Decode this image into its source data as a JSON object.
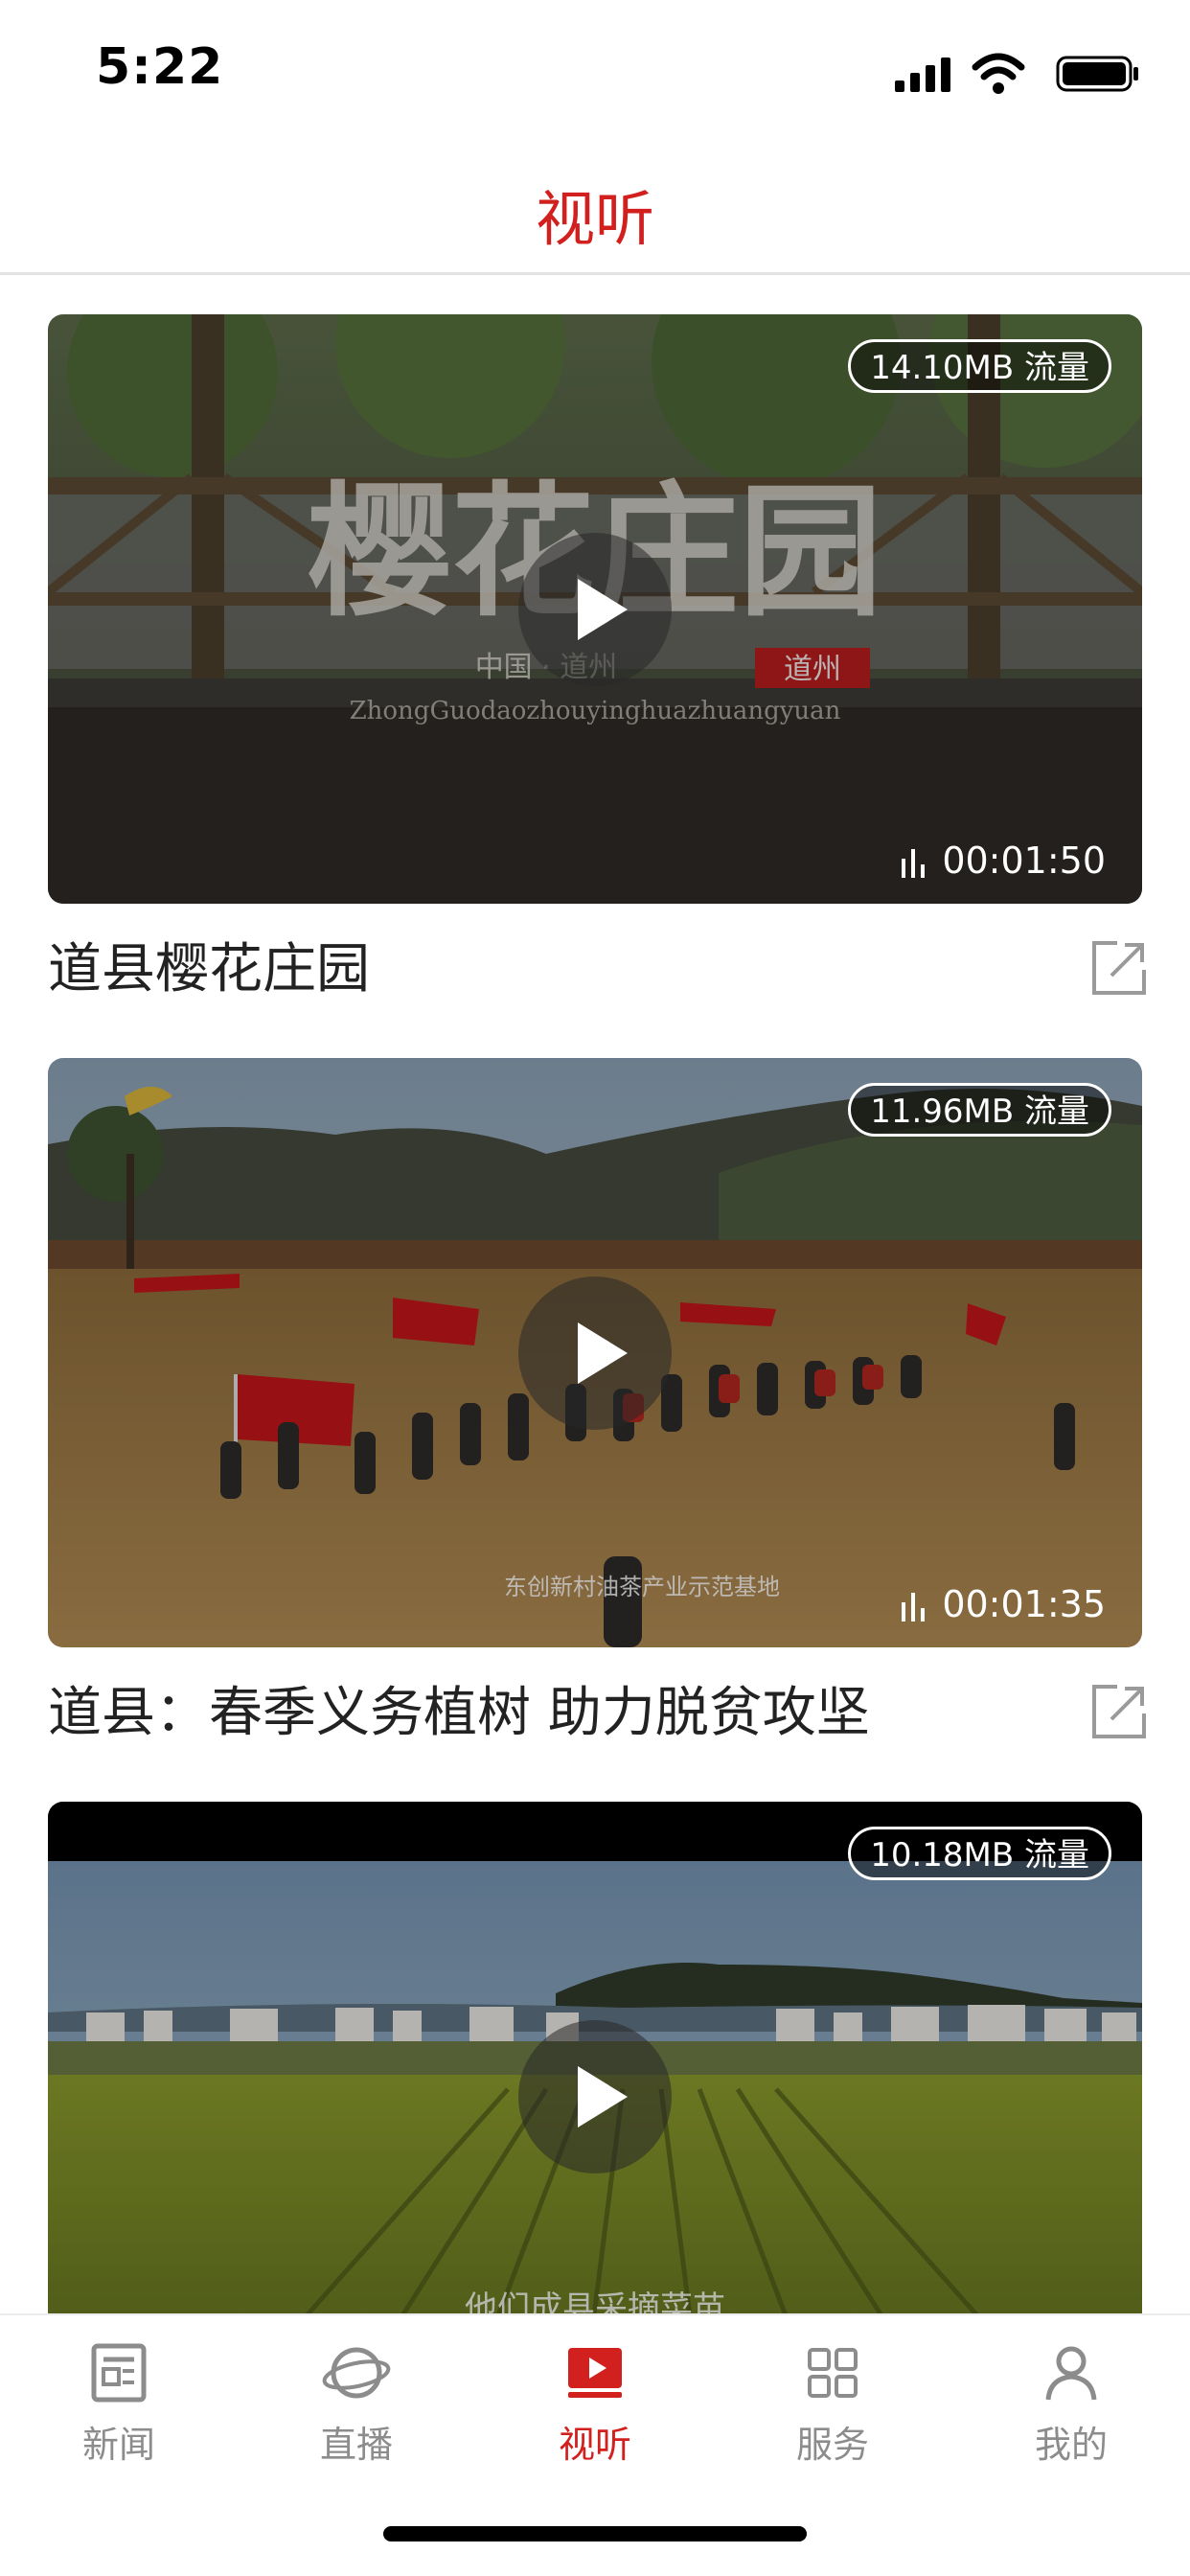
{
  "status_bar": {
    "time": "5:22"
  },
  "header": {
    "title": "视听"
  },
  "videos": [
    {
      "title": "道县樱花庄园",
      "size_badge": "14.10MB 流量",
      "duration": "00:01:50",
      "thumb_overlay_title": "樱花庄园",
      "thumb_overlay_sub": "中国 · 道州",
      "thumb_overlay_stamp": "道州",
      "thumb_overlay_pinyin": "ZhongGuodaozhouyinghuazhuangyuan"
    },
    {
      "title": "道县：春季义务植树 助力脱贫攻坚",
      "size_badge": "11.96MB 流量",
      "duration": "00:01:35",
      "thumb_overlay_caption": "东创新村油茶产业示范基地"
    },
    {
      "title": "",
      "size_badge": "10.18MB 流量",
      "thumb_overlay_caption": "他们成县采摘菜苗"
    }
  ],
  "tabs": [
    {
      "label": "新闻",
      "icon": "news-icon",
      "active": false
    },
    {
      "label": "直播",
      "icon": "live-icon",
      "active": false
    },
    {
      "label": "视听",
      "icon": "video-icon",
      "active": true
    },
    {
      "label": "服务",
      "icon": "grid-icon",
      "active": false
    },
    {
      "label": "我的",
      "icon": "profile-icon",
      "active": false
    }
  ],
  "colors": {
    "accent": "#d2201e",
    "tab_inactive": "#8c8c8c",
    "title_text": "#222222"
  }
}
